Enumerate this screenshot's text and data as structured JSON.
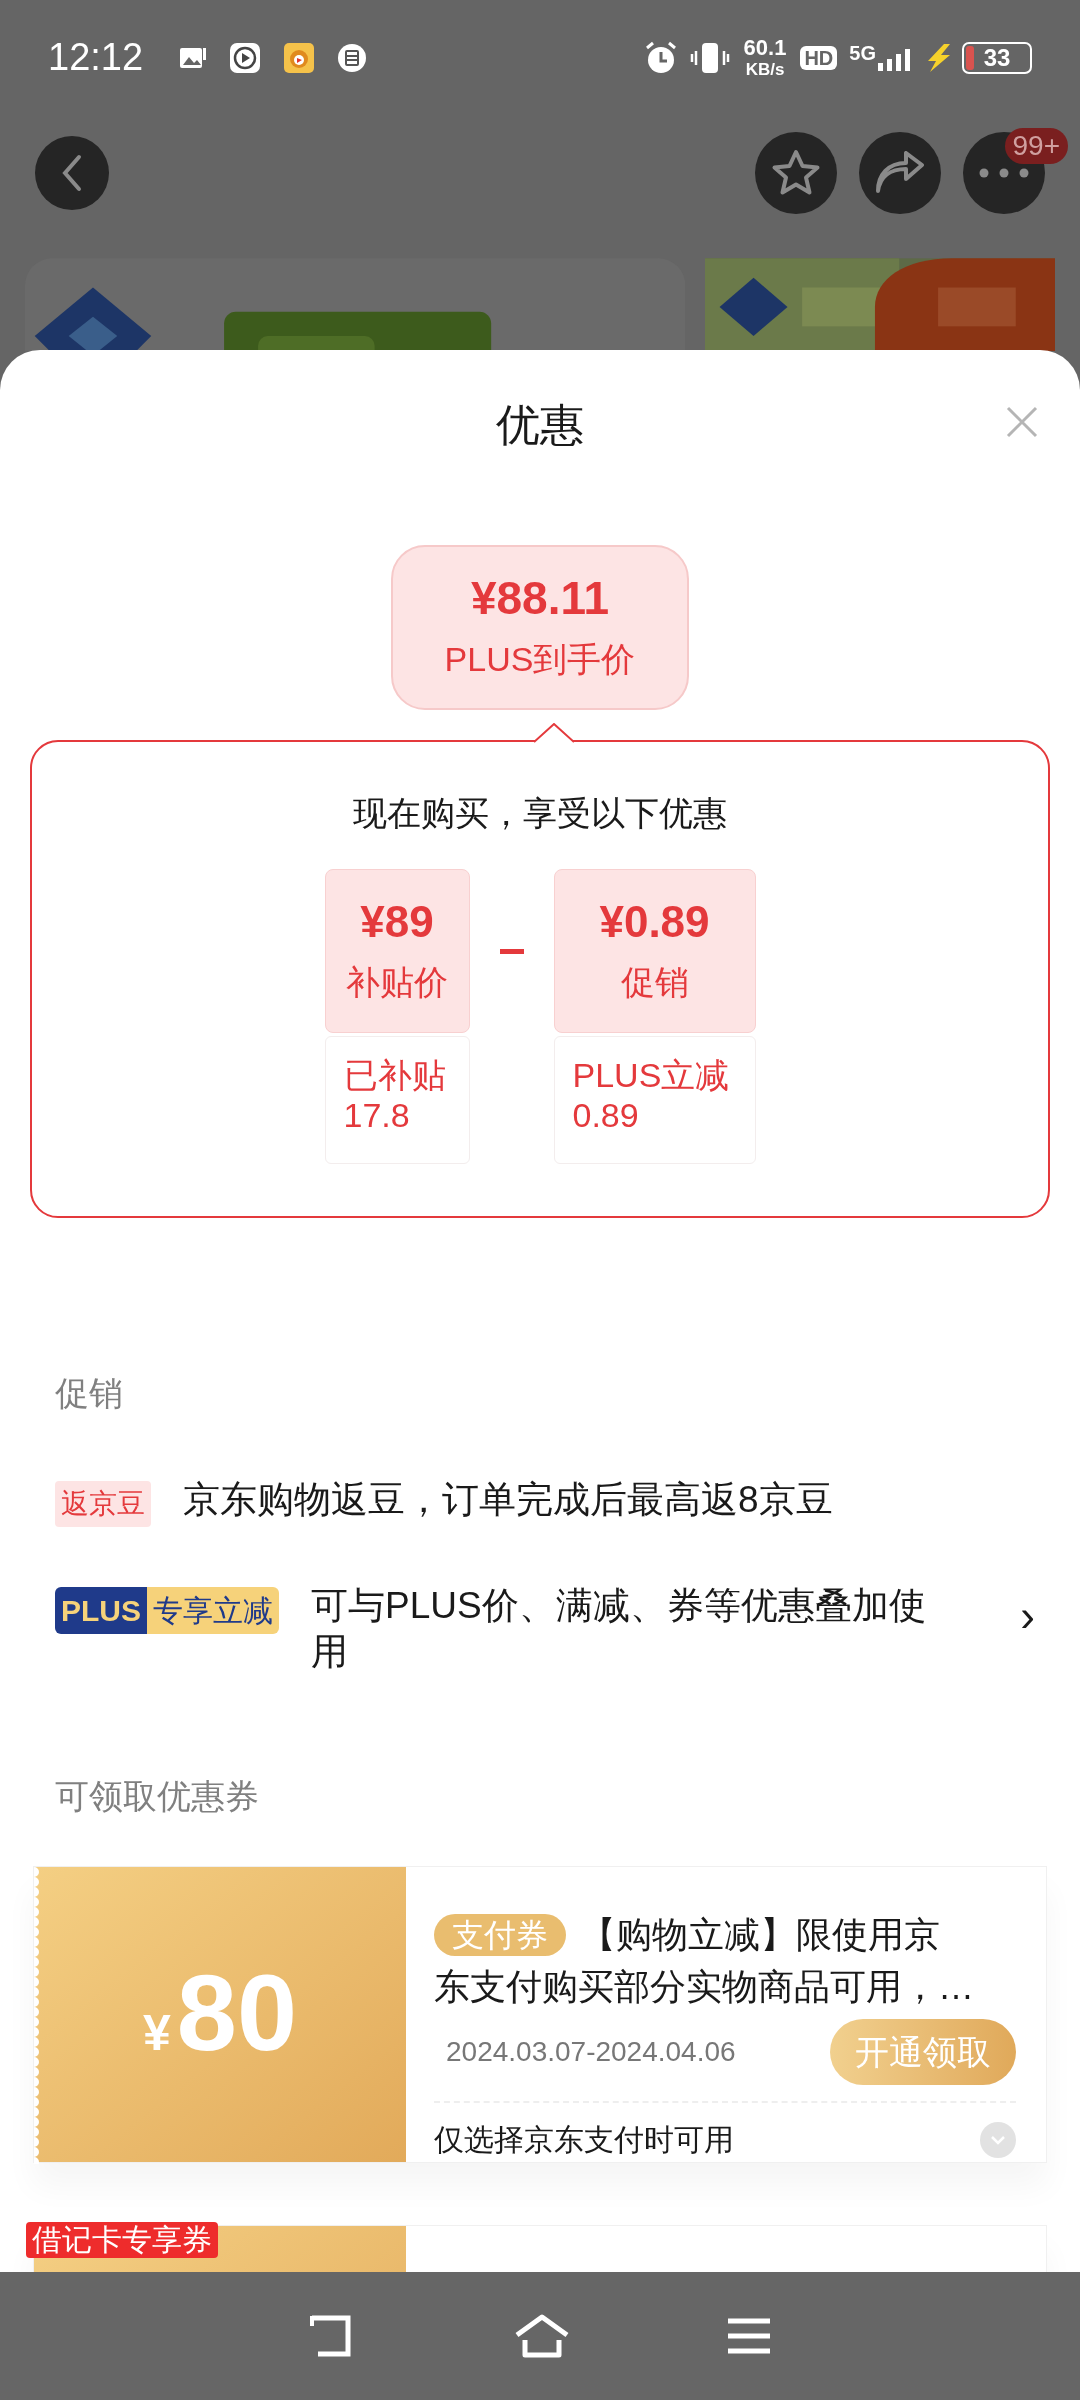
{
  "status_bar": {
    "time": "12:12",
    "net_speed": "60.1",
    "net_unit": "KB/s",
    "hd": "HD",
    "network": "5G",
    "battery": "33"
  },
  "top_bar": {
    "badge": "99+"
  },
  "sheet": {
    "title": "优惠"
  },
  "price_bubble": {
    "price": "¥88.11",
    "label": "PLUS到手价"
  },
  "breakdown": {
    "heading": "现在购买，享受以下优惠",
    "items": [
      {
        "price": "¥89",
        "label": "补贴价",
        "detail": "已补贴\n17.8"
      },
      {
        "price": "¥0.89",
        "label": "促销",
        "detail": "PLUS立减\n0.89"
      }
    ]
  },
  "promotions": {
    "heading": "促销",
    "items": [
      {
        "kind": "tag",
        "tags": [
          "返京豆"
        ],
        "text": "京东购物返豆，订单完成后最高返8京豆"
      },
      {
        "kind": "plus",
        "tags": [
          "PLUS",
          "专享立减"
        ],
        "text": "可与PLUS价、满减、券等优惠叠加使用",
        "chevron": "›"
      }
    ]
  },
  "coupons": {
    "heading": "可领取优惠券",
    "items": [
      {
        "kind": "full",
        "currency": "¥",
        "amount": "80",
        "tag": "支付券",
        "title_lines": [
          "【购物立减】限使用京",
          "东支付购买部分实物商品可用，…"
        ],
        "dates": "2024.03.07-2024.04.06",
        "button": "开通领取",
        "note": "仅选择京东支付时可用"
      },
      {
        "kind": "partial",
        "ribbon": "借记卡专享券"
      }
    ]
  }
}
